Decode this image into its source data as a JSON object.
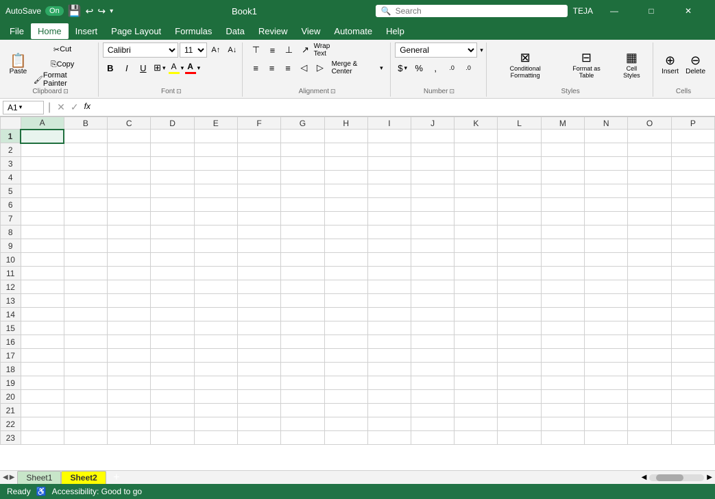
{
  "titleBar": {
    "autosave_label": "AutoSave",
    "autosave_state": "On",
    "title": "Book1",
    "search_placeholder": "Search",
    "user": "TEJA",
    "undo_label": "↩",
    "redo_label": "↪"
  },
  "menuBar": {
    "items": [
      {
        "label": "File",
        "id": "file"
      },
      {
        "label": "Home",
        "id": "home",
        "active": true
      },
      {
        "label": "Insert",
        "id": "insert"
      },
      {
        "label": "Page Layout",
        "id": "page-layout"
      },
      {
        "label": "Formulas",
        "id": "formulas"
      },
      {
        "label": "Data",
        "id": "data"
      },
      {
        "label": "Review",
        "id": "review"
      },
      {
        "label": "View",
        "id": "view"
      },
      {
        "label": "Automate",
        "id": "automate"
      },
      {
        "label": "Help",
        "id": "help"
      }
    ]
  },
  "ribbon": {
    "clipboard": {
      "label": "Clipboard",
      "paste_label": "Paste",
      "cut_label": "Cut",
      "copy_label": "Copy",
      "format_painter_label": "Format Painter"
    },
    "font": {
      "label": "Font",
      "font_name": "Calibri",
      "font_size": "11",
      "bold_label": "B",
      "italic_label": "I",
      "underline_label": "U",
      "increase_font_label": "A↑",
      "decrease_font_label": "A↓",
      "borders_label": "⊞",
      "fill_color_label": "A",
      "font_color_label": "A"
    },
    "alignment": {
      "label": "Alignment",
      "wrap_text_label": "Wrap Text",
      "merge_center_label": "Merge & Center",
      "align_top": "⊤",
      "align_middle": "≡",
      "align_bottom": "⊥",
      "align_left": "≡",
      "align_center": "≡",
      "align_right": "≡",
      "indent_dec": "◁",
      "indent_inc": "▷",
      "orient_label": "↗",
      "expand_label": "⊞"
    },
    "number": {
      "label": "Number",
      "format": "General",
      "currency_label": "$",
      "percent_label": "%",
      "comma_label": ",",
      "increase_decimal": ".0→.00",
      "decrease_decimal": ".00→.0",
      "expand_label": "⊞"
    },
    "styles": {
      "label": "Styles",
      "conditional_label": "Conditional Formatting",
      "format_table_label": "Format as Table",
      "cell_styles_label": "Cell Styles"
    },
    "cells": {
      "label": "Cells",
      "insert_label": "Insert",
      "delete_label": "Delete"
    }
  },
  "formulaBar": {
    "cell_ref": "A1",
    "formula": ""
  },
  "sheet": {
    "columns": [
      "A",
      "B",
      "C",
      "D",
      "E",
      "F",
      "G",
      "H",
      "I",
      "J",
      "K",
      "L",
      "M",
      "N",
      "O",
      "P"
    ],
    "row_count": 23,
    "active_cell": "A1"
  },
  "tabs": {
    "sheet1": "Sheet1",
    "sheet2": "Sheet2",
    "add_label": "+"
  },
  "statusBar": {
    "ready": "Ready",
    "accessibility": "Accessibility: Good to go"
  }
}
